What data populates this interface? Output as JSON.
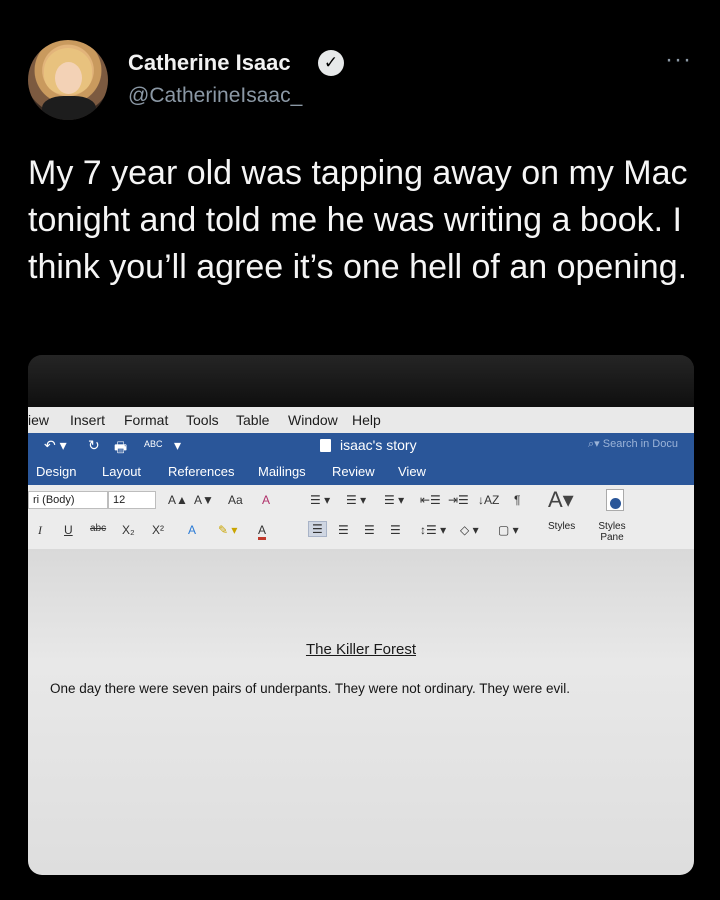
{
  "tweet": {
    "user_name": "Catherine Isaac",
    "user_handle": "@CatherineIsaac_",
    "verified_icon": "checkmark-badge-icon",
    "more_icon": "···",
    "text": "My 7 year old was tapping away on my Mac tonight and told me he was writing a book. I think you’ll agree it’s one hell of an opening."
  },
  "photo": {
    "menubar": [
      "iew",
      "Insert",
      "Format",
      "Tools",
      "Table",
      "Window",
      "Help"
    ],
    "quick_access": [
      "↶ ▾",
      "↻",
      "🖶",
      "ABC",
      "▾"
    ],
    "doc_title": "isaac's story",
    "search_placeholder": "Search in Docu",
    "tabs": [
      "Design",
      "Layout",
      "References",
      "Mailings",
      "Review",
      "View"
    ],
    "ribbon": {
      "font_name": "ri (Body)",
      "font_size": "12",
      "grow_font": "A▲",
      "shrink_font": "A▼",
      "change_case": "Aa",
      "clear_format": "A",
      "italic": "I",
      "underline": "U",
      "strike": "abc",
      "subscript": "X₂",
      "superscript": "X²",
      "text_effects": "A",
      "font_color": "A",
      "pilcrow": "¶",
      "styles_label": "Styles",
      "styles_pane_label": "Styles Pane"
    },
    "document": {
      "heading": "The Killer Forest",
      "body": "One day there were seven pairs of underpants. They were not ordinary. They were evil."
    }
  }
}
